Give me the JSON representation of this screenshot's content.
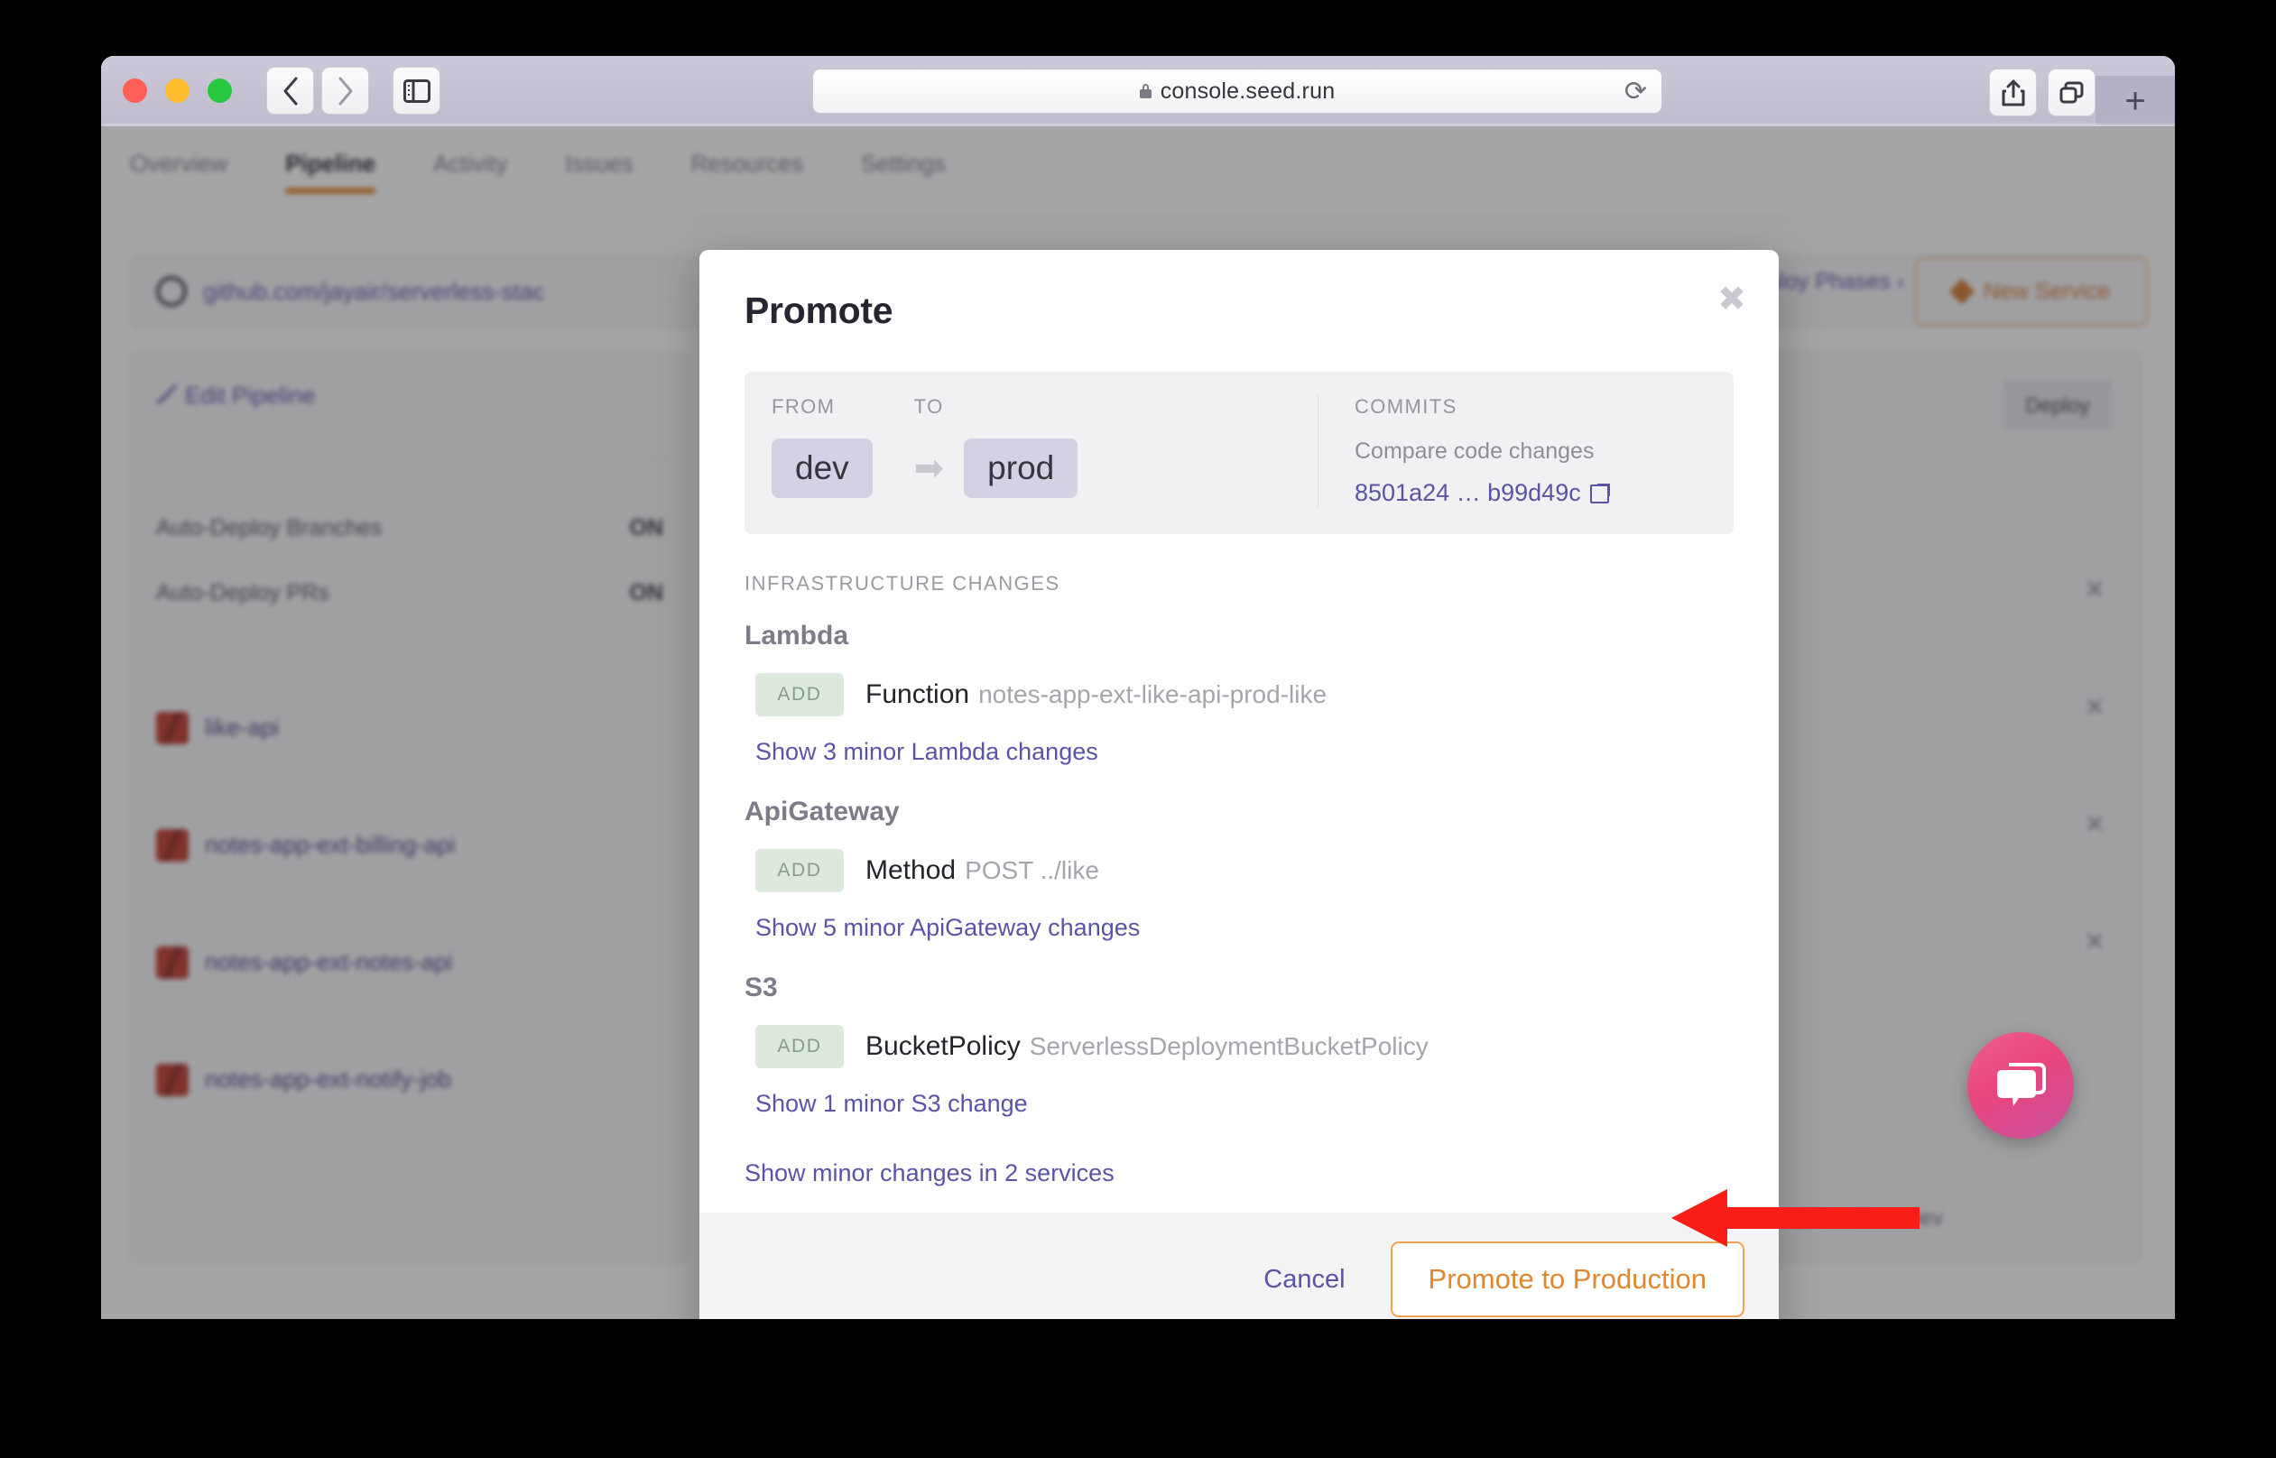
{
  "browser": {
    "url": "console.seed.run",
    "lock_icon": "lock-icon",
    "back_icon": "chevron-left-icon",
    "forward_icon": "chevron-right-icon",
    "sidebar_icon": "sidebar-toggle-icon",
    "reload_icon": "reload-icon",
    "share_icon": "share-icon",
    "tabs_overview_icon": "tab-overview-icon",
    "new_tab_label": "+"
  },
  "page": {
    "nav_tabs": [
      {
        "label": "Overview",
        "active": false
      },
      {
        "label": "Pipeline",
        "active": true
      },
      {
        "label": "Activity",
        "active": false
      },
      {
        "label": "Issues",
        "active": false
      },
      {
        "label": "Resources",
        "active": false
      },
      {
        "label": "Settings",
        "active": false
      }
    ],
    "repo_url": "github.com/jayair/serverless-stac",
    "deploy_phases_label": "Deploy Phases ›",
    "new_service_label": "New Service",
    "edit_pipeline_label": "Edit Pipeline",
    "settings": [
      {
        "label": "Auto-Deploy Branches",
        "value": "ON"
      },
      {
        "label": "Auto-Deploy PRs",
        "value": "ON"
      }
    ],
    "services": [
      {
        "name": "like-api"
      },
      {
        "name": "notes-app-ext-billing-api"
      },
      {
        "name": "notes-app-ext-notes-api"
      },
      {
        "name": "notes-app-ext-notify-job"
      }
    ],
    "deploy_button_label": "Deploy",
    "from_dev_label": "from dev",
    "accent_orange": "#e0892c",
    "link_purple": "#5b54a6"
  },
  "modal": {
    "title": "Promote",
    "close_label": "✖",
    "summary": {
      "from_label": "From",
      "from_value": "dev",
      "to_label": "To",
      "to_value": "prod",
      "arrow": "➡",
      "commits_label": "Commits",
      "compare_text": "Compare code changes",
      "sha_range": "8501a24 … b99d49c",
      "external_link_icon": "external-link-icon"
    },
    "section_label": "Infrastructure changes",
    "groups": [
      {
        "name": "Lambda",
        "changes": [
          {
            "badge": "ADD",
            "type": "Function",
            "resource": "notes-app-ext-like-api-prod-like"
          }
        ],
        "minor_link": "Show 3 minor Lambda changes"
      },
      {
        "name": "ApiGateway",
        "changes": [
          {
            "badge": "ADD",
            "type": "Method",
            "resource": "POST ../like"
          }
        ],
        "minor_link": "Show 5 minor ApiGateway changes"
      },
      {
        "name": "S3",
        "changes": [
          {
            "badge": "ADD",
            "type": "BucketPolicy",
            "resource": "ServerlessDeploymentBucketPolicy"
          }
        ],
        "minor_link": "Show 1 minor S3 change"
      }
    ],
    "show_all_minor_link": "Show minor changes in 2 services",
    "cancel_label": "Cancel",
    "promote_label": "Promote to Production",
    "promote_border_color": "#f0a351",
    "promote_text_color": "#e08730"
  },
  "annotation": {
    "arrow_color": "#fb1d17",
    "points_to": "Promote to Production"
  },
  "chat": {
    "icon": "chat-bubble-icon",
    "color": "#e8457e"
  }
}
